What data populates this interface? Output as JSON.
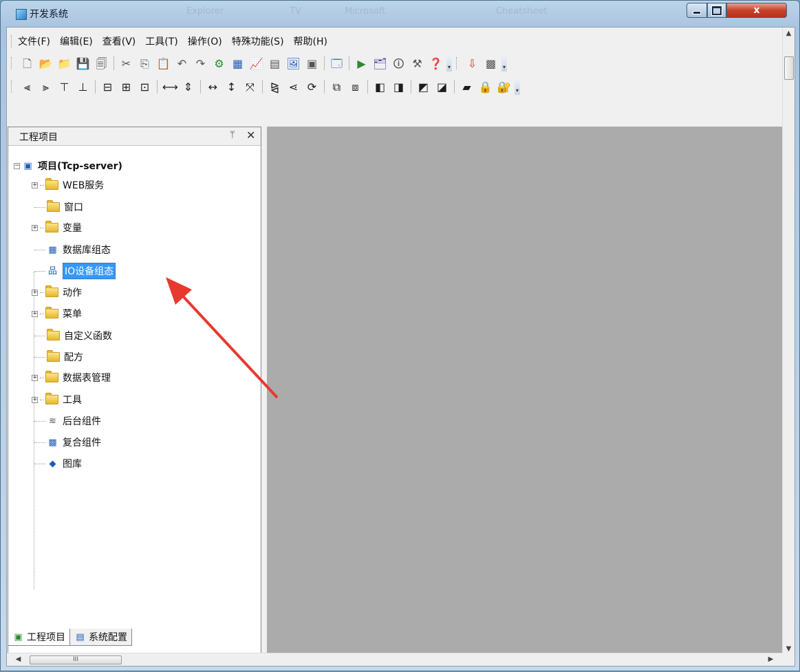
{
  "window": {
    "title": "开发系统",
    "ghost_titles": [
      "Explorer",
      "TV",
      "Microsoft",
      "Cheatsheet"
    ],
    "controls": {
      "close_glyph": "x"
    }
  },
  "menubar": {
    "items": [
      "文件(F)",
      "编辑(E)",
      "查看(V)",
      "工具(T)",
      "操作(O)",
      "特殊功能(S)",
      "帮助(H)"
    ]
  },
  "toolbar1": {
    "buttons": [
      {
        "name": "new-file-icon",
        "glyph": "🗋"
      },
      {
        "name": "open-folder-icon",
        "glyph": "📂"
      },
      {
        "name": "open-project-icon",
        "glyph": "📁"
      },
      {
        "name": "save-icon",
        "glyph": "💾"
      },
      {
        "name": "save-all-icon",
        "glyph": "🗐"
      },
      {
        "name": "cut-icon",
        "glyph": "✂"
      },
      {
        "name": "copy-icon",
        "glyph": "⎘"
      },
      {
        "name": "paste-icon",
        "glyph": "📋"
      },
      {
        "name": "undo-icon",
        "glyph": "↶"
      },
      {
        "name": "redo-icon",
        "glyph": "↷"
      },
      {
        "name": "component-icon",
        "glyph": "⚙"
      },
      {
        "name": "grid-icon",
        "glyph": "▦"
      },
      {
        "name": "trend-icon",
        "glyph": "📈"
      },
      {
        "name": "table-icon",
        "glyph": "▤"
      },
      {
        "name": "window-icon",
        "glyph": "🖼"
      },
      {
        "name": "report-icon",
        "glyph": "▣"
      },
      {
        "name": "page-icon",
        "glyph": "🗔"
      },
      {
        "name": "run-icon",
        "glyph": "▶"
      },
      {
        "name": "config-icon",
        "glyph": "🗂"
      },
      {
        "name": "properties-icon",
        "glyph": "🛈"
      },
      {
        "name": "tools-icon",
        "glyph": "⚒"
      },
      {
        "name": "help-icon",
        "glyph": "❓"
      },
      {
        "name": "download-icon",
        "glyph": "⇩"
      },
      {
        "name": "composite-icon",
        "glyph": "▩"
      }
    ]
  },
  "toolbar2": {
    "buttons": [
      {
        "name": "align-left-icon",
        "glyph": "⫷"
      },
      {
        "name": "align-right-icon",
        "glyph": "⫸"
      },
      {
        "name": "align-top-icon",
        "glyph": "⊤"
      },
      {
        "name": "align-bottom-icon",
        "glyph": "⊥"
      },
      {
        "name": "center-horizontal-icon",
        "glyph": "⊟"
      },
      {
        "name": "center-vertical-icon",
        "glyph": "⊞"
      },
      {
        "name": "center-both-icon",
        "glyph": "⊡"
      },
      {
        "name": "space-horizontal-icon",
        "glyph": "⟷"
      },
      {
        "name": "space-vertical-icon",
        "glyph": "⇕"
      },
      {
        "name": "same-width-icon",
        "glyph": "↔"
      },
      {
        "name": "same-height-icon",
        "glyph": "↕"
      },
      {
        "name": "same-size-icon",
        "glyph": "⤧"
      },
      {
        "name": "flip-horizontal-icon",
        "glyph": "⧎"
      },
      {
        "name": "flip-vertical-icon",
        "glyph": "⋖"
      },
      {
        "name": "rotate-icon",
        "glyph": "⟳"
      },
      {
        "name": "group-icon",
        "glyph": "⧉"
      },
      {
        "name": "ungroup-icon",
        "glyph": "⧈"
      },
      {
        "name": "bring-front-icon",
        "glyph": "◧"
      },
      {
        "name": "send-back-icon",
        "glyph": "◨"
      },
      {
        "name": "move-up-icon",
        "glyph": "◩"
      },
      {
        "name": "move-down-icon",
        "glyph": "◪"
      },
      {
        "name": "lock-icon",
        "glyph": "🔒"
      },
      {
        "name": "layer-icon",
        "glyph": "▰"
      },
      {
        "name": "secure-icon",
        "glyph": "🔐"
      }
    ]
  },
  "panel": {
    "title": "工程项目",
    "pin_glyph": "ᛘ",
    "close_glyph": "✕"
  },
  "tree": {
    "root": "项目(Tcp-server)",
    "items": [
      {
        "label": "WEB服务",
        "expandable": true
      },
      {
        "label": "窗口",
        "expandable": false
      },
      {
        "label": "变量",
        "expandable": true
      },
      {
        "label": "数据库组态",
        "expandable": false
      },
      {
        "label": "IO设备组态",
        "expandable": false,
        "selected": true
      },
      {
        "label": "动作",
        "expandable": true
      },
      {
        "label": "菜单",
        "expandable": true
      },
      {
        "label": "自定义函数",
        "expandable": false
      },
      {
        "label": "配方",
        "expandable": false
      },
      {
        "label": "数据表管理",
        "expandable": true
      },
      {
        "label": "工具",
        "expandable": true
      },
      {
        "label": "后台组件",
        "expandable": false
      },
      {
        "label": "复合组件",
        "expandable": false
      },
      {
        "label": "图库",
        "expandable": false
      }
    ]
  },
  "tabs": {
    "project": "工程项目",
    "system_config": "系统配置"
  },
  "hscroll": {
    "thumb_label": "III"
  },
  "annotation": {
    "color": "#e8392e"
  }
}
